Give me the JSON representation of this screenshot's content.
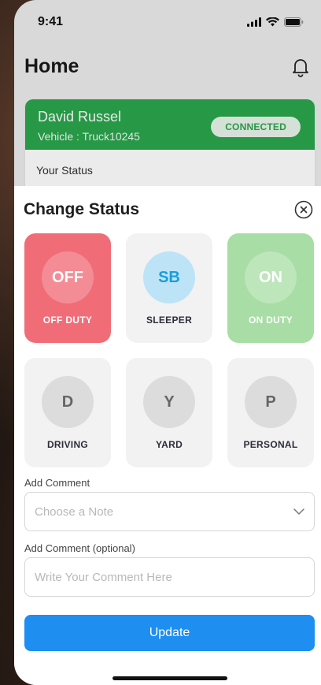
{
  "status_bar": {
    "time": "9:41"
  },
  "home": {
    "title": "Home",
    "driver_name": "David Russel",
    "vehicle": "Vehicle : Truck10245",
    "connection_status": "CONNECTED",
    "your_status_label": "Your Status"
  },
  "sheet": {
    "title": "Change Status",
    "statuses": [
      {
        "code": "OFF",
        "label": "OFF DUTY"
      },
      {
        "code": "SB",
        "label": "SLEEPER"
      },
      {
        "code": "ON",
        "label": "ON DUTY"
      },
      {
        "code": "D",
        "label": "DRIVING"
      },
      {
        "code": "Y",
        "label": "YARD"
      },
      {
        "code": "P",
        "label": "PERSONAL"
      }
    ],
    "comment_label": "Add Comment",
    "note_placeholder": "Choose a Note",
    "optional_comment_label": "Add Comment (optional)",
    "comment_placeholder": "Write Your Comment Here",
    "update_label": "Update"
  },
  "colors": {
    "connected_green": "#2aa54c",
    "off_duty_red": "#f06d78",
    "on_duty_green": "#a8dda5",
    "sleeper_blue": "#1a9edb",
    "primary_blue": "#1e8ef0"
  }
}
